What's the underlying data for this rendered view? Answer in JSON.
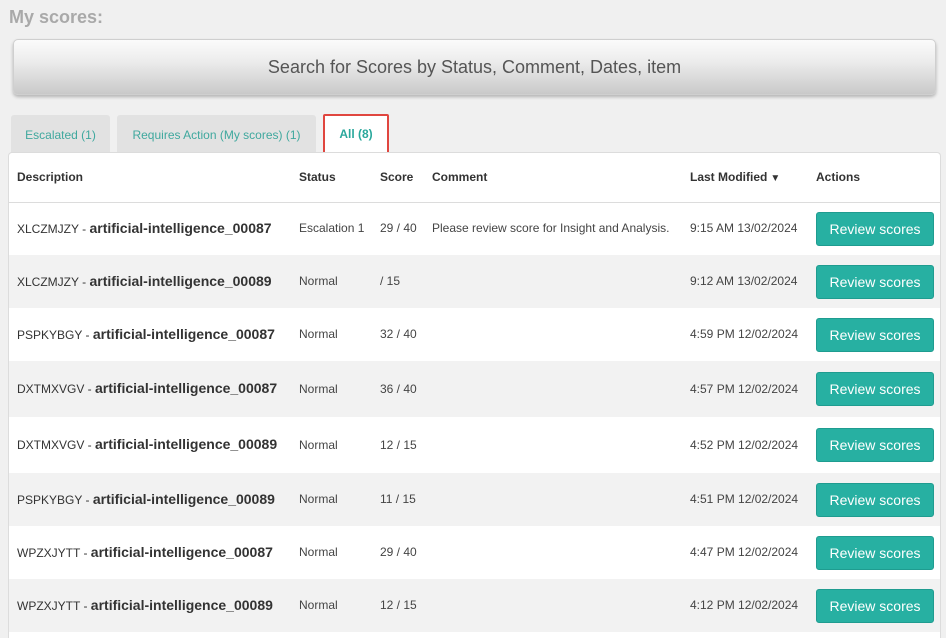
{
  "page": {
    "title": "My scores:"
  },
  "search": {
    "label": "Search for Scores by Status, Comment, Dates, item"
  },
  "tabs": [
    {
      "label": "Escalated (1)"
    },
    {
      "label": "Requires Action (My scores) (1)"
    },
    {
      "label": "All (8)"
    }
  ],
  "colors": {
    "accent": "#27b0a2",
    "active_tab_border": "#e0463f",
    "tab_text": "#3fa89e"
  },
  "table": {
    "headers": {
      "description": "Description",
      "status": "Status",
      "score": "Score",
      "comment": "Comment",
      "last_modified": "Last Modified",
      "actions": "Actions"
    },
    "sort_icon": "▼",
    "action_label": "Review scores",
    "rows": [
      {
        "code": "XLCZMJZY -",
        "item": "artificial-intelligence_00087",
        "status": "Escalation 1",
        "score": "29 / 40",
        "comment": "Please review score for Insight and Analysis.",
        "modified": "9:15 AM 13/02/2024"
      },
      {
        "code": "XLCZMJZY -",
        "item": "artificial-intelligence_00089",
        "status": "Normal",
        "score": "/ 15",
        "comment": "",
        "modified": "9:12 AM 13/02/2024"
      },
      {
        "code": "PSPKYBGY -",
        "item": "artificial-intelligence_00087",
        "status": "Normal",
        "score": "32 / 40",
        "comment": "",
        "modified": "4:59 PM 12/02/2024"
      },
      {
        "code": "DXTMXVGV -",
        "item": "artificial-intelligence_00087",
        "status": "Normal",
        "score": "36 / 40",
        "comment": "",
        "modified": "4:57 PM 12/02/2024"
      },
      {
        "code": "DXTMXVGV -",
        "item": "artificial-intelligence_00089",
        "status": "Normal",
        "score": "12 / 15",
        "comment": "",
        "modified": "4:52 PM 12/02/2024"
      },
      {
        "code": "PSPKYBGY -",
        "item": "artificial-intelligence_00089",
        "status": "Normal",
        "score": "11 / 15",
        "comment": "",
        "modified": "4:51 PM 12/02/2024"
      },
      {
        "code": "WPZXJYTT -",
        "item": "artificial-intelligence_00087",
        "status": "Normal",
        "score": "29 / 40",
        "comment": "",
        "modified": "4:47 PM 12/02/2024"
      },
      {
        "code": "WPZXJYTT -",
        "item": "artificial-intelligence_00089",
        "status": "Normal",
        "score": "12 / 15",
        "comment": "",
        "modified": "4:12 PM 12/02/2024"
      }
    ]
  }
}
